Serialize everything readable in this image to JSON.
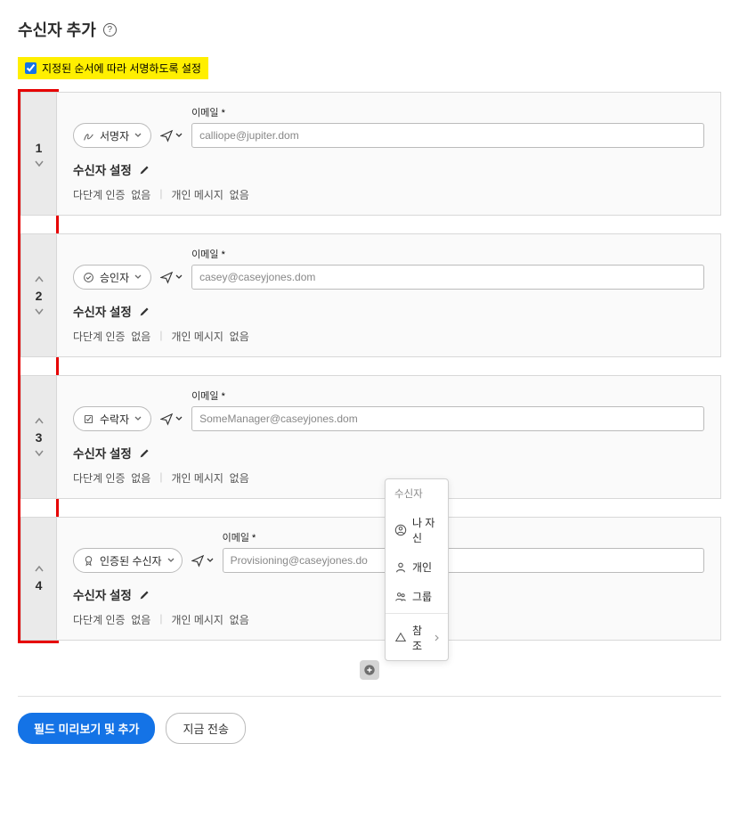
{
  "page": {
    "title": "수신자 추가"
  },
  "order_signing": {
    "label": "지정된 순서에 따라 서명하도록 설정",
    "checked": true
  },
  "email_label": "이메일",
  "required_mark": "*",
  "settings_title": "수신자 설정",
  "mfa_label": "다단계 인증",
  "mfa_value": "없음",
  "msg_label": "개인 메시지",
  "msg_value": "없음",
  "recipients": [
    {
      "index": "1",
      "role_label": "서명자",
      "email": "calliope@jupiter.dom",
      "has_up": false,
      "has_down": true
    },
    {
      "index": "2",
      "role_label": "승인자",
      "email": "casey@caseyjones.dom",
      "has_up": true,
      "has_down": true
    },
    {
      "index": "3",
      "role_label": "수락자",
      "email": "SomeManager@caseyjones.dom",
      "has_up": true,
      "has_down": true
    },
    {
      "index": "4",
      "role_label": "인증된 수신자",
      "email": "Provisioning@caseyjones.do",
      "has_up": true,
      "has_down": false,
      "wide": true
    }
  ],
  "popup": {
    "header": "수신자",
    "items": {
      "myself": "나 자신",
      "individual": "개인",
      "group": "그룹",
      "cc": "참조"
    }
  },
  "actions": {
    "preview": "필드 미리보기 및 추가",
    "send": "지금 전송"
  }
}
